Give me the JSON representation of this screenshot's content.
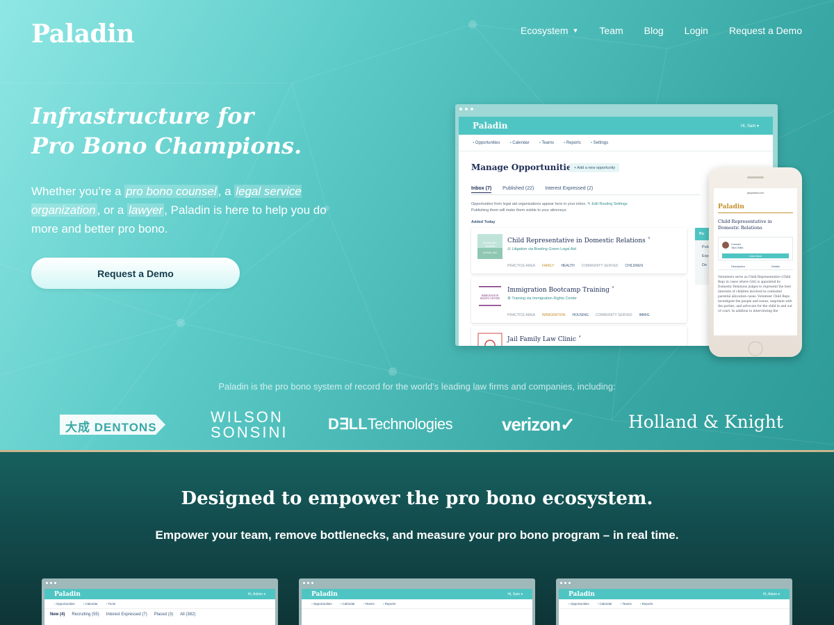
{
  "header": {
    "logo": "Paladin",
    "nav": [
      {
        "label": "Ecosystem",
        "dropdown": true
      },
      {
        "label": "Team"
      },
      {
        "label": "Blog"
      },
      {
        "label": "Login"
      },
      {
        "label": "Request a Demo"
      }
    ]
  },
  "hero": {
    "headline_line1": "Infrastructure for",
    "headline_line2": "Pro Bono Champions.",
    "lead_parts": [
      "Whether you’re a ",
      "pro bono counsel",
      ", a ",
      "legal service organization",
      ", or a ",
      "lawyer",
      ", Paladin is here to help you do more and better pro bono."
    ],
    "cta_label": "Request a Demo"
  },
  "mockup": {
    "app_name": "Paladin",
    "user": "Hi, Sam ▾",
    "nav": [
      "Opportunities",
      "Calendar",
      "Teams",
      "Reports",
      "Settings"
    ],
    "title": "Manage Opportunities",
    "add_button": "+ Add a new opportunity",
    "tabs": [
      "Inbox (7)",
      "Published (22)",
      "Interest Expressed (2)"
    ],
    "info_line1": "Opportunites from legal aid organizations appear here in your inbox.",
    "info_link": "✎ Edit Routing Settings",
    "info_line2": "Publishing them will make them visible to your attorneys.",
    "added_today": "Added Today",
    "cards": [
      {
        "title": "Child Representative in Domestic Relations ˅",
        "subtitle": "⚖ Litigation  via  Bowling Green Legal Aid",
        "meta": [
          "PRACTICE AREA",
          "FAMILY",
          "HEALTH",
          "COMMUNITY SERVED",
          "CHILDREN"
        ],
        "thumb_text": "BOWLING GREEN LEGAL AID"
      },
      {
        "title": "Immigration Bootcamp Training ˅",
        "subtitle": "⚙ Training  via  Immigration Rights Center",
        "meta": [
          "PRACTICE AREA",
          "IMMIGRATION",
          "HOUSING",
          "COMMUNITY SERVED",
          "IMMIG"
        ],
        "thumb_text": "IMMIGRATION RIGHTS CENTER"
      },
      {
        "title": "Jail Family Law Clinic ˅",
        "subtitle": "",
        "meta": [],
        "thumb_text": ""
      }
    ],
    "side_panel": [
      "Pu",
      "Publi",
      "Expre",
      "De"
    ]
  },
  "phone": {
    "url": "joinpaladin.com",
    "brand": "Paladin",
    "title": "Child Representative in Domestic Relations",
    "contact_label": "Contact",
    "contact_name": "Tara Wills",
    "learn_more": "Learn More",
    "tabs": [
      "Description",
      "Details"
    ],
    "body": "Volunteers serve as Child Representative (Child Rep) in cases where GAG is appointed by Domestic Relations judges to represent the best interests of children involved in contested parental allocation cases. Volunteer Child Reps investigate the people and issues, negotiate with the parties, and advocate for the child in and out of court. In addition to interviewing the"
  },
  "trust": {
    "text": "Paladin is the pro bono system of record for the world’s leading law firms and companies, including:",
    "logos": {
      "dentons": "大成 DENTONS",
      "wilson_line1": "WILSON",
      "wilson_line2": "SONSINI",
      "dell_bold": "D∃LL",
      "dell_rest": "Technologies",
      "verizon": "verizon✓",
      "holland": "Holland & Knight"
    }
  },
  "section2": {
    "title": "Designed to empower the pro bono ecosystem.",
    "subtitle": "Empower your team, remove bottlenecks, and measure your pro bono program – in real time.",
    "screens": [
      {
        "brand": "Paladin",
        "user": "Hi, Admin ▾",
        "nav": [
          "Opportunities",
          "Calendar",
          "Tools"
        ],
        "tabs": [
          "New (4)",
          "Recruiting (55)",
          "Interest Expressed (7)",
          "Placed (3)",
          "All (382)"
        ]
      },
      {
        "brand": "Paladin",
        "user": "Hi, Sam ▾",
        "nav": [
          "Opportunities",
          "Calendar",
          "Teams",
          "Reports"
        ],
        "tabs": []
      },
      {
        "brand": "Paladin",
        "user": "Hi, Adam ▾",
        "nav": [
          "Opportunities",
          "Calendar",
          "Teams",
          "Reports"
        ],
        "tabs": []
      }
    ]
  },
  "colors": {
    "hero_start": "#8fe7e4",
    "hero_end": "#2d9a97",
    "accent": "#4fc5c3",
    "navy": "#1c2c55",
    "dark_section": "#134d4e",
    "gold_rule": "#c9b58a"
  }
}
